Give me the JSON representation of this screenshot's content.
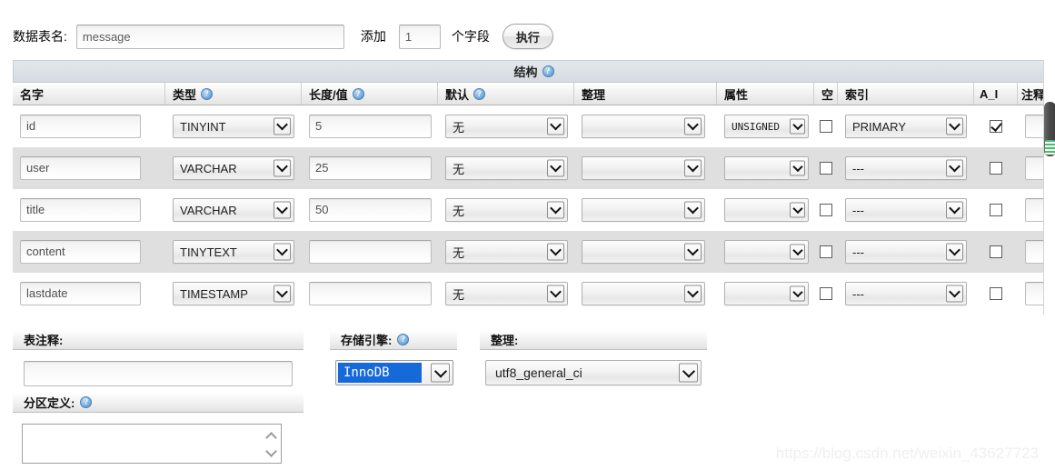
{
  "topbar": {
    "table_name_label": "数据表名:",
    "table_name_value": "message",
    "add_label": "添加",
    "add_count": "1",
    "fields_label": "个字段",
    "go_label": "执行"
  },
  "structure": {
    "title": "结构",
    "help_glyph": "?",
    "columns": [
      {
        "label": "名字",
        "help": false
      },
      {
        "label": "类型",
        "help": true
      },
      {
        "label": "长度/值",
        "help": true
      },
      {
        "label": "默认",
        "help": true
      },
      {
        "label": "整理",
        "help": false
      },
      {
        "label": "属性",
        "help": false
      },
      {
        "label": "空",
        "help": false
      },
      {
        "label": "索引",
        "help": false
      },
      {
        "label": "A_I",
        "help": false
      },
      {
        "label": "注释",
        "help": false
      }
    ],
    "rows": [
      {
        "name": "id",
        "type": "TINYINT",
        "length": "5",
        "default": "无",
        "collation": "",
        "attributes": "UNSIGNED",
        "null": false,
        "index": "PRIMARY",
        "ai": true,
        "comment": ""
      },
      {
        "name": "user",
        "type": "VARCHAR",
        "length": "25",
        "default": "无",
        "collation": "",
        "attributes": "",
        "null": false,
        "index": "---",
        "ai": false,
        "comment": ""
      },
      {
        "name": "title",
        "type": "VARCHAR",
        "length": "50",
        "default": "无",
        "collation": "",
        "attributes": "",
        "null": false,
        "index": "---",
        "ai": false,
        "comment": ""
      },
      {
        "name": "content",
        "type": "TINYTEXT",
        "length": "",
        "default": "无",
        "collation": "",
        "attributes": "",
        "null": false,
        "index": "---",
        "ai": false,
        "comment": ""
      },
      {
        "name": "lastdate",
        "type": "TIMESTAMP",
        "length": "",
        "default": "无",
        "collation": "",
        "attributes": "",
        "null": false,
        "index": "---",
        "ai": false,
        "comment": ""
      }
    ]
  },
  "panels": {
    "comment": {
      "label": "表注释:",
      "value": ""
    },
    "engine": {
      "label": "存储引擎:",
      "value": "InnoDB"
    },
    "collation": {
      "label": "整理:",
      "value": "utf8_general_ci"
    },
    "partition": {
      "label": "分区定义:",
      "value": ""
    }
  },
  "watermark": "https://blog.csdn.net/weixin_43627723",
  "colors": {
    "row_stripe": "#dfdfdf",
    "header_band": "#d5dbe1",
    "selection_blue": "#1569d8",
    "scroll_grip_green": "#3fc46a"
  }
}
